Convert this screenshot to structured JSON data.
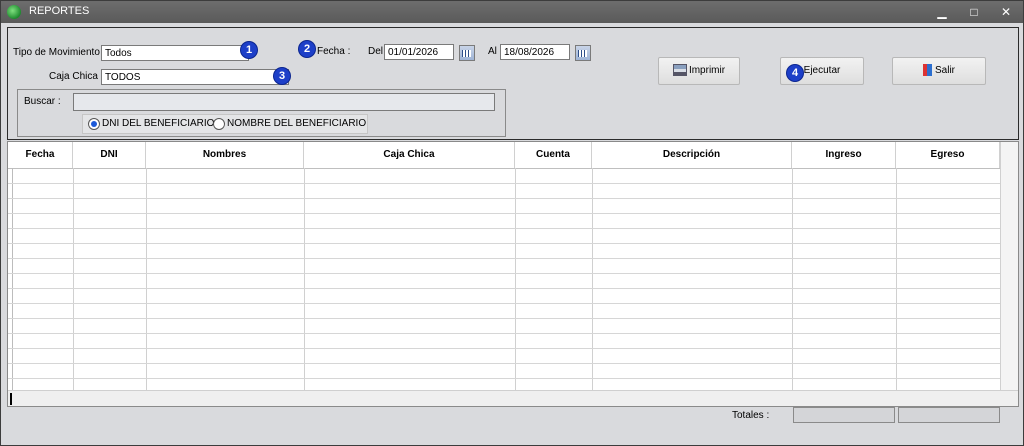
{
  "window": {
    "title": "REPORTES",
    "min": "▁",
    "max": "□",
    "close": "✕"
  },
  "filters": {
    "tipo_label": "Tipo de Movimiento :",
    "tipo_value": "Todos",
    "caja_label": "Caja Chica :",
    "caja_value": "TODOS",
    "fecha_label": "Fecha :",
    "del_label": "Del",
    "del_value": "01/01/2026",
    "al_label": "Al",
    "al_value": "18/08/2026",
    "buscar_label": "Buscar :",
    "buscar_value": "",
    "radio_dni": "DNI DEL BENEFICIARIO",
    "radio_nombre": "NOMBRE DEL BENEFICIARIO",
    "radio_selected": "dni"
  },
  "badges": [
    "1",
    "2",
    "3",
    "4"
  ],
  "buttons": {
    "imprimir": "Imprimir",
    "ejecutar": "Ejecutar",
    "salir": "Salir"
  },
  "icons": {
    "imprimir": "printer-icon",
    "salir": "exit-door-icon",
    "calendar": "calendar-icon"
  },
  "table": {
    "columns": [
      "Fecha",
      "DNI",
      "Nombres",
      "Caja Chica",
      "Cuenta",
      "Descripción",
      "Ingreso",
      "Egreso"
    ],
    "rows": []
  },
  "footer": {
    "totales_label": "Totales :",
    "total_ingreso": "",
    "total_egreso": ""
  },
  "colors": {
    "badge": "#1d3fc8",
    "titlebar": "#5f5f5f"
  }
}
